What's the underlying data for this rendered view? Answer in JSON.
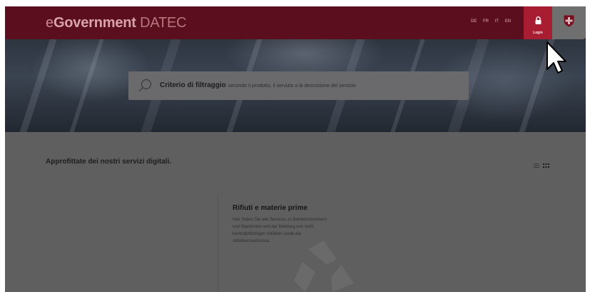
{
  "header": {
    "brand_prefix": "e",
    "brand_bold": "Government",
    "brand_suffix": " DATEC",
    "languages": [
      "DE",
      "FR",
      "IT",
      "EN"
    ],
    "login_label": "Login"
  },
  "search": {
    "placeholder_bold": "Criterio di filtraggio",
    "placeholder_rest": "secondo il prodotto, il servizio o la descrizione del servizio"
  },
  "main": {
    "section_title": "Approfittate dei nostri servizi digitali.",
    "card": {
      "title": "Rifiuti e materie prime",
      "description_lines": [
        "Hier finden Sie alle Services zu Betriebsnummern",
        "und Standorten und der Meldung von nicht",
        "kontrollpflichtigen Abfällen sowie die",
        "Abfallverzeichnisse."
      ]
    }
  },
  "icons": [
    "search-icon",
    "lock-icon",
    "swiss-cross-icon",
    "list-view-icon",
    "grid-view-icon",
    "recycle-icon",
    "mouse-cursor-icon"
  ],
  "colors": {
    "header": "#5b0e1e",
    "login": "#a91d32",
    "overlay": "#5f5f5f"
  }
}
